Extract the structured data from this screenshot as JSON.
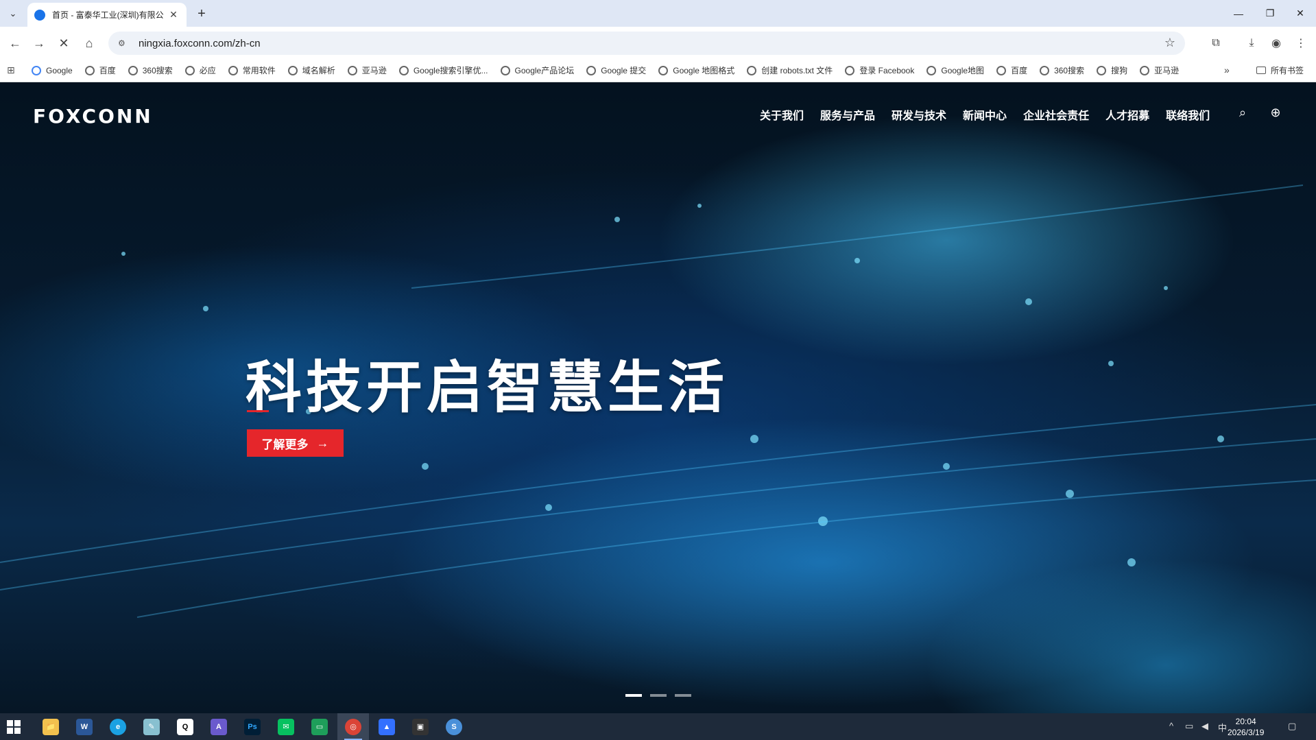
{
  "browser": {
    "tab_title": "首页 - 富泰华工业(深圳)有限公",
    "url": "ningxia.foxconn.com/zh-cn",
    "bookmarks": [
      "Google",
      "百度",
      "360搜索",
      "必应",
      "常用软件",
      "域名解析",
      "亚马逊",
      "Google搜索引擎优...",
      "Google产品论坛",
      "Google 提交",
      "Google 地图格式",
      "创建 robots.txt 文件",
      "登录 Facebook",
      "Google地图",
      "百度",
      "360搜索",
      "搜狗",
      "亚马逊"
    ],
    "all_bookmarks": "所有书签"
  },
  "site": {
    "logo": "FOXCONN",
    "nav": [
      "关于我们",
      "服务与产品",
      "研发与技术",
      "新闻中心",
      "企业社会责任",
      "人才招募",
      "联络我们"
    ],
    "hero": {
      "title": "科技开启智慧生活",
      "cta": "了解更多",
      "slide_count": 3,
      "active_slide": 1
    }
  },
  "taskbar": {
    "apps": [
      "file-explorer",
      "word",
      "edge",
      "notepad",
      "qq",
      "app",
      "photoshop",
      "wechat",
      "monitor",
      "chrome",
      "feishu",
      "video",
      "browser"
    ],
    "ime": "中",
    "time": "20:04",
    "date": "2026/3/19"
  },
  "colors": {
    "accent": "#e5262b",
    "tab_bg": "#dfe7f5"
  }
}
